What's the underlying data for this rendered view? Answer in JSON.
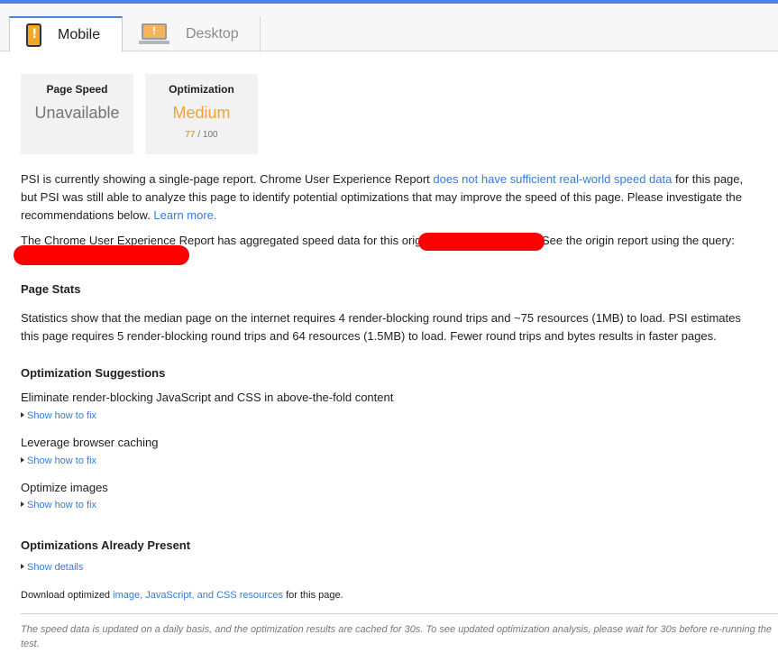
{
  "tabs": {
    "mobile": {
      "label": "Mobile",
      "icon": "mobile-phone-warning-icon"
    },
    "desktop": {
      "label": "Desktop",
      "icon": "desktop-monitor-warning-icon"
    }
  },
  "scores": {
    "page_speed": {
      "title": "Page Speed",
      "value": "Unavailable"
    },
    "optimization": {
      "title": "Optimization",
      "value": "Medium",
      "score": "77",
      "max": "/ 100"
    }
  },
  "intro": {
    "text1": "PSI is currently showing a single-page report. Chrome User Experience Report ",
    "link1": "does not have sufficient real-world speed data",
    "text2": " for this page, but PSI was still able to analyze this page to identify potential optimizations that may improve the speed of this page. Please investigate the recommendations below. ",
    "link2": "Learn more."
  },
  "origin": {
    "text1": "The Chrome User Experience Report has aggregated speed data for this origin",
    "text2": "See the origin report using the query:"
  },
  "page_stats": {
    "heading": "Page Stats",
    "text": "Statistics show that the median page on the internet requires 4 render-blocking round trips and ~75 resources (1MB) to load. PSI estimates this page requires 5 render-blocking round trips and 64 resources (1.5MB) to load. Fewer round trips and bytes results in faster pages."
  },
  "suggestions": {
    "heading": "Optimization Suggestions",
    "items": [
      {
        "title": "Eliminate render-blocking JavaScript and CSS in above-the-fold content",
        "action": "Show how to fix"
      },
      {
        "title": "Leverage browser caching",
        "action": "Show how to fix"
      },
      {
        "title": "Optimize images",
        "action": "Show how to fix"
      }
    ]
  },
  "present": {
    "heading": "Optimizations Already Present",
    "action": "Show details"
  },
  "download": {
    "prefix": "Download optimized ",
    "link": "image, JavaScript, and CSS resources",
    "suffix": " for this page."
  },
  "footer_note": "The speed data is updated on a daily basis, and the optimization results are cached for 30s. To see updated optimization analysis, please wait for 30s before re-running the test.",
  "colors": {
    "accent": "#4d7fe6",
    "medium": "#f1a13a",
    "link": "#3a7bd5",
    "redaction": "#ff0000"
  }
}
